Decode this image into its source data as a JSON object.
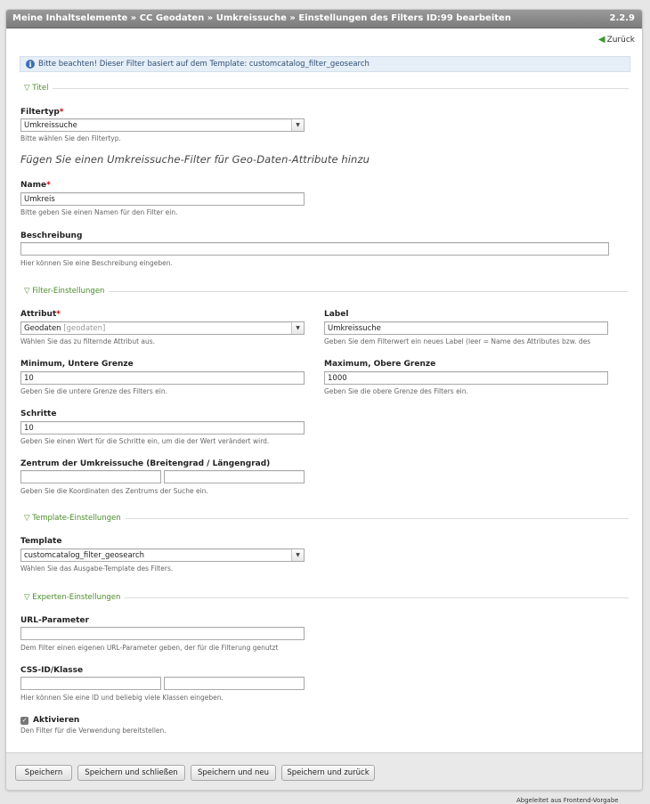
{
  "header": {
    "title": "Meine Inhaltselemente » CC Geodaten » Umkreissuche » Einstellungen des Filters ID:99 bearbeiten",
    "version": "2.2.9"
  },
  "back_link": "Zurück",
  "notice": "Bitte beachten! Dieser Filter basiert auf dem Template: customcatalog_filter_geosearch",
  "sections": {
    "titel": "Titel",
    "filter": "Filter-Einstellungen",
    "template": "Template-Einstellungen",
    "experten": "Experten-Einstellungen"
  },
  "fields": {
    "filtertyp": {
      "label": "Filtertyp",
      "value": "Umkreissuche",
      "help": "Bitte wählen Sie den Filtertyp."
    },
    "description_text": "Fügen Sie einen Umkreissuche-Filter für Geo-Daten-Attribute hinzu",
    "name": {
      "label": "Name",
      "value": "Umkreis",
      "help": "Bitte geben Sie einen Namen für den Filter ein."
    },
    "beschreibung": {
      "label": "Beschreibung",
      "value": "",
      "help": "Hier können Sie eine Beschreibung eingeben."
    },
    "attribut": {
      "label": "Attribut",
      "value": "Geodaten",
      "value_hint": "[geodaten]",
      "help": "Wählen Sie das zu filternde Attribut aus."
    },
    "label": {
      "label": "Label",
      "value": "Umkreissuche",
      "help": "Geben Sie dem Filterwert ein neues Label (leer = Name des Attributes bzw. des"
    },
    "minimum": {
      "label": "Minimum, Untere Grenze",
      "value": "10",
      "help": "Geben Sie die untere Grenze des Filters ein."
    },
    "maximum": {
      "label": "Maximum, Obere Grenze",
      "value": "1000",
      "help": "Geben Sie die obere Grenze des Filters ein."
    },
    "schritte": {
      "label": "Schritte",
      "value": "10",
      "help": "Geben Sie einen Wert für die Schritte ein, um die der Wert verändert wird."
    },
    "zentrum": {
      "label": "Zentrum der Umkreissuche (Breitengrad / Längengrad)",
      "lat": "",
      "lng": "",
      "help": "Geben Sie die Koordinaten des Zentrums der Suche ein."
    },
    "template": {
      "label": "Template",
      "value": "customcatalog_filter_geosearch",
      "help": "Wählen Sie das Ausgabe-Template des Filters."
    },
    "url_param": {
      "label": "URL-Parameter",
      "value": "",
      "help": "Dem Filter einen eigenen URL-Parameter geben, der für die Filterung genutzt"
    },
    "css": {
      "label": "CSS-ID/Klasse",
      "id_value": "",
      "class_value": "",
      "help": "Hier können Sie eine ID und beliebig viele Klassen eingeben."
    },
    "aktivieren": {
      "label": "Aktivieren",
      "checked": true,
      "help": "Den Filter für die Verwendung bereitstellen."
    }
  },
  "required_marker": "*",
  "buttons": {
    "save": "Speichern",
    "save_close": "Speichern und schließen",
    "save_new": "Speichern und neu",
    "save_back": "Speichern und zurück"
  },
  "footer_text": "Abgeleitet aus Frontend-Vorgabe",
  "colors": {
    "titlebar": "#8a8a8a",
    "legend_text": "#4c8c2b",
    "required": "#cc0000",
    "notice_bg": "#e6eef7"
  }
}
